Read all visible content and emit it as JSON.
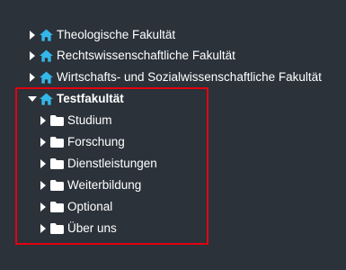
{
  "tree": {
    "accent_color": "#34b6e8",
    "highlight_color": "#e3000f",
    "items": [
      {
        "label": "Theologische Fakultät",
        "icon": "home-icon",
        "expanded": false
      },
      {
        "label": "Rechtswissenschaftliche Fakultät",
        "icon": "home-icon",
        "expanded": false
      },
      {
        "label": "Wirtschafts- und Sozialwissenschaftliche Fakultät",
        "icon": "home-icon",
        "expanded": false
      },
      {
        "label": "Testfakultät",
        "icon": "home-icon",
        "expanded": true,
        "children": [
          {
            "label": "Studium",
            "icon": "folder-icon"
          },
          {
            "label": "Forschung",
            "icon": "folder-icon"
          },
          {
            "label": "Dienstleistungen",
            "icon": "folder-icon"
          },
          {
            "label": "Weiterbildung",
            "icon": "folder-icon"
          },
          {
            "label": "Optional",
            "icon": "folder-icon"
          },
          {
            "label": "Über uns",
            "icon": "folder-icon"
          }
        ]
      }
    ]
  }
}
